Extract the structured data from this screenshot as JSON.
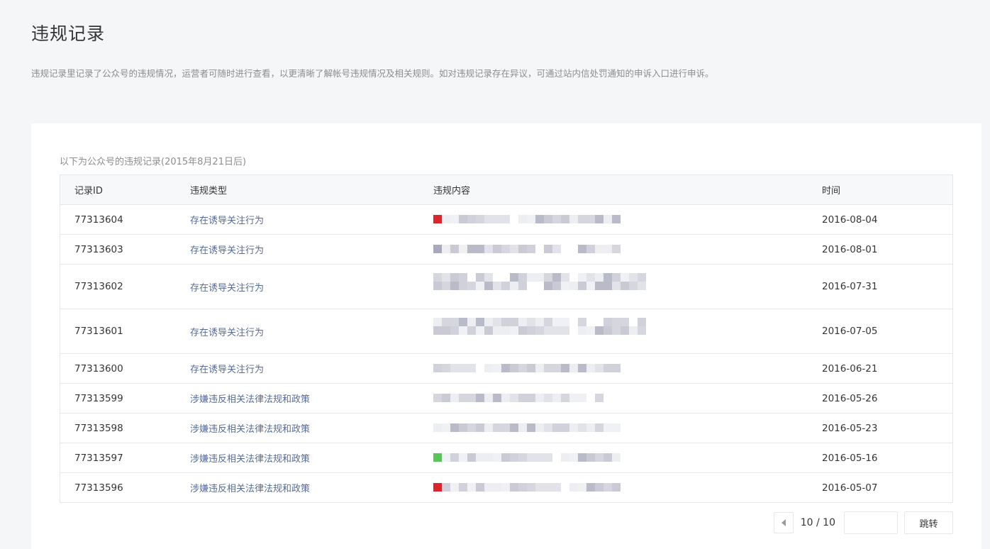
{
  "header": {
    "title": "违规记录",
    "description": "违规记录里记录了公众号的违规情况，运营者可随时进行查看，以更清晰了解帐号违规情况及相关规则。如对违规记录存在异议，可通过站内信处罚通知的申诉入口进行申诉。"
  },
  "table": {
    "caption": "以下为公众号的违规记录(2015年8月21日后)",
    "columns": [
      "记录ID",
      "违规类型",
      "违规内容",
      "时间"
    ],
    "rows": [
      {
        "id": "77313604",
        "type": "存在诱导关注行为",
        "time": "2016-08-04",
        "accent": "#d9262c",
        "lines": 1
      },
      {
        "id": "77313603",
        "type": "存在诱导关注行为",
        "time": "2016-08-01",
        "accent": "#a8a9ba",
        "lines": 1
      },
      {
        "id": "77313602",
        "type": "存在诱导关注行为",
        "time": "2016-07-31",
        "accent": "",
        "lines": 2
      },
      {
        "id": "77313601",
        "type": "存在诱导关注行为",
        "time": "2016-07-05",
        "accent": "",
        "lines": 2
      },
      {
        "id": "77313600",
        "type": "存在诱导关注行为",
        "time": "2016-06-21",
        "accent": "",
        "lines": 1
      },
      {
        "id": "77313599",
        "type": "涉嫌违反相关法律法规和政策",
        "time": "2016-05-26",
        "accent": "",
        "lines": 1
      },
      {
        "id": "77313598",
        "type": "涉嫌违反相关法律法规和政策",
        "time": "2016-05-23",
        "accent": "",
        "lines": 1
      },
      {
        "id": "77313597",
        "type": "涉嫌违反相关法律法规和政策",
        "time": "2016-05-16",
        "accent": "#5cc25c",
        "lines": 1
      },
      {
        "id": "77313596",
        "type": "涉嫌违反相关法律法规和政策",
        "time": "2016-05-07",
        "accent": "#d9262c",
        "lines": 1
      }
    ]
  },
  "pagination": {
    "prev_icon": "chevron-left-icon",
    "info": "10 / 10",
    "input_value": "",
    "jump_label": "跳转"
  }
}
